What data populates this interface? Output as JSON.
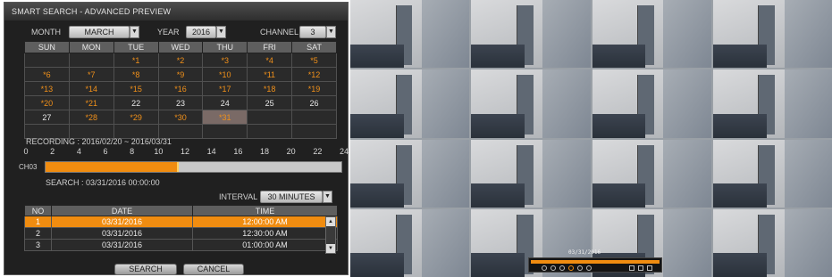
{
  "title": "SMART SEARCH - ADVANCED PREVIEW",
  "month": {
    "label": "MONTH",
    "value": "MARCH"
  },
  "year": {
    "label": "YEAR",
    "value": "2016"
  },
  "channel": {
    "label": "CHANNEL",
    "value": "3"
  },
  "dropdown_glyph": "▼",
  "calendar": {
    "days": [
      "SUN",
      "MON",
      "TUE",
      "WED",
      "THU",
      "FRI",
      "SAT"
    ],
    "weeks": [
      [
        "",
        "",
        "*1",
        "*2",
        "*3",
        "*4",
        "*5"
      ],
      [
        "*6",
        "*7",
        "*8",
        "*9",
        "*10",
        "*11",
        "*12"
      ],
      [
        "*13",
        "*14",
        "*15",
        "*16",
        "*17",
        "*18",
        "*19"
      ],
      [
        "*20",
        "*21",
        "22",
        "23",
        "24",
        "25",
        "26"
      ],
      [
        "27",
        "*28",
        "*29",
        "*30",
        "*31",
        "",
        ""
      ],
      [
        "",
        "",
        "",
        "",
        "",
        "",
        ""
      ]
    ],
    "selected": "*31"
  },
  "recording": "RECORDING : 2016/02/20 ~ 2016/03/31",
  "timeline": {
    "ticks": [
      "0",
      "2",
      "4",
      "6",
      "8",
      "10",
      "12",
      "14",
      "16",
      "18",
      "20",
      "22",
      "24"
    ],
    "channel_label": "CH03",
    "recorded_fraction": 0.45
  },
  "search_time": "SEARCH : 03/31/2016 00:00:00",
  "interval": {
    "label": "INTERVAL",
    "value": "30 MINUTES"
  },
  "results": {
    "headers": [
      "NO",
      "DATE",
      "TIME"
    ],
    "rows": [
      [
        "1",
        "03/31/2016",
        "12:00:00 AM"
      ],
      [
        "2",
        "03/31/2016",
        "12:30:00 AM"
      ],
      [
        "3",
        "03/31/2016",
        "01:00:00 AM"
      ]
    ]
  },
  "buttons": {
    "search": "SEARCH",
    "cancel": "CANCEL"
  },
  "playback": {
    "stamp": "03/31/2016"
  },
  "colors": {
    "accent": "#f08c10",
    "panel": "#202020"
  }
}
